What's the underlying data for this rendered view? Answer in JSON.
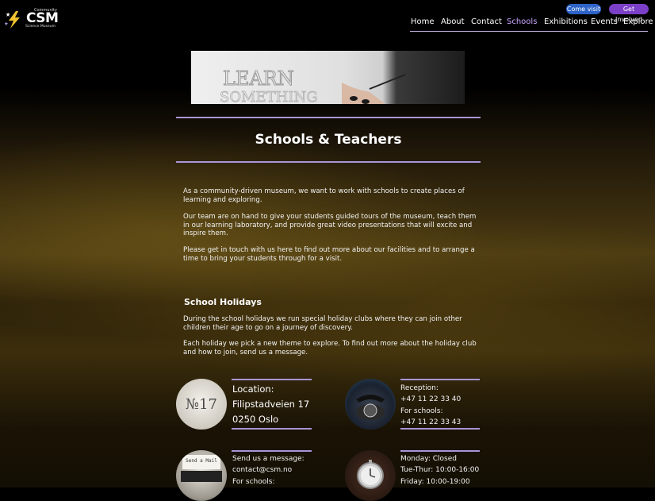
{
  "logo": {
    "top_text": "Community",
    "main_text": "CSM",
    "sub_text": "Science Museum"
  },
  "header_buttons": {
    "visit": "Come visit",
    "involved": "Get Involved"
  },
  "nav": {
    "items": [
      {
        "label": "Home",
        "active": false
      },
      {
        "label": "About",
        "active": false
      },
      {
        "label": "Contact",
        "active": false
      },
      {
        "label": "Schools",
        "active": true
      },
      {
        "label": "Exhibitions",
        "active": false
      },
      {
        "label": "Events",
        "active": false
      },
      {
        "label": "Explore",
        "active": false
      }
    ]
  },
  "hero": {
    "image_text_1": "LEARN",
    "image_text_2": "SOMETHING"
  },
  "page": {
    "title": "Schools & Teachers",
    "intro": [
      "As a community-driven museum, we want to work with schools to create places of learning and exploring.",
      "Our team are on hand to give your students guided tours of the museum, teach them in our learning laboratory, and provide great video presentations that will excite and inspire them.",
      "Please get in touch with us here to find out more about our facilities and to arrange a time to bring your students through for a visit."
    ],
    "holidays_heading": "School Holidays",
    "holidays": [
      "During the school holidays we run special holiday clubs where they can join other children their age to go on a journey of discovery.",
      "Each holiday we pick a new theme to explore. To find out more about the holiday club and how to join, send us a message."
    ]
  },
  "contact": {
    "location": {
      "image_text": "№17",
      "lines": [
        "Location:",
        "Filipstadveien 17",
        "0250 Oslo"
      ]
    },
    "phone": {
      "lines": [
        "Reception:",
        "+47 11 22 33 40",
        "For schools:",
        "+47 11 22 33 43"
      ]
    },
    "message": {
      "image_text": "Send a Mail",
      "lines": [
        "Send us a message:",
        "contact@csm.no",
        "For schools:"
      ]
    },
    "hours": {
      "lines": [
        "Monday: Closed",
        "Tue-Thur: 10:00-16:00",
        "Friday: 10:00-19:00"
      ]
    }
  },
  "colors": {
    "accent_purple": "#a895d6",
    "active_nav": "#c8a6ff",
    "visit_button": "#2d63c8",
    "involved_button": "#7c3fc7"
  }
}
